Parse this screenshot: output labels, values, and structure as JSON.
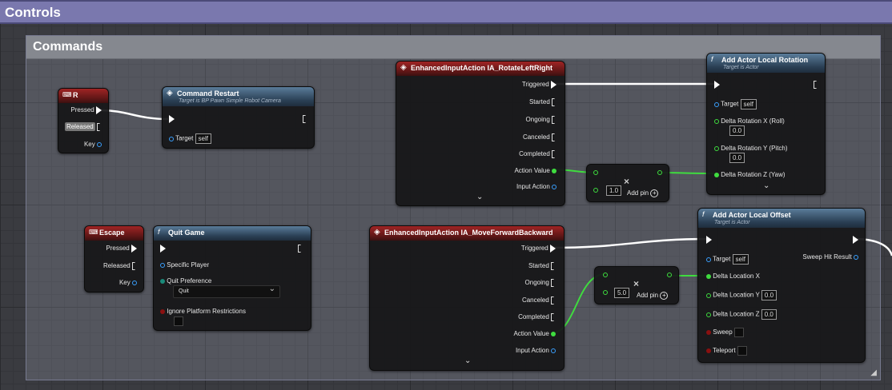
{
  "top_title": "Controls",
  "comment_title": "Commands",
  "nodes": {
    "key_r": {
      "title": "R",
      "pressed": "Pressed",
      "released": "Released",
      "key": "Key"
    },
    "command_restart": {
      "title": "Command Restart",
      "subtitle": "Target is BP Pawn Simple Robot Camera",
      "target": "Target",
      "target_value": "self"
    },
    "ia_rotate": {
      "title": "EnhancedInputAction IA_RotateLeftRight",
      "triggered": "Triggered",
      "started": "Started",
      "ongoing": "Ongoing",
      "canceled": "Canceled",
      "completed": "Completed",
      "action_value": "Action Value",
      "input_action": "Input Action"
    },
    "multiply_1": {
      "symbol": "×",
      "value": "1.0",
      "add_pin": "Add pin"
    },
    "add_rotation": {
      "title": "Add Actor Local Rotation",
      "subtitle": "Target is Actor",
      "target": "Target",
      "target_value": "self",
      "dx": "Delta Rotation X (Roll)",
      "dx_value": "0.0",
      "dy": "Delta Rotation Y (Pitch)",
      "dy_value": "0.0",
      "dz": "Delta Rotation Z (Yaw)"
    },
    "key_escape": {
      "title": "Escape",
      "pressed": "Pressed",
      "released": "Released",
      "key": "Key"
    },
    "quit_game": {
      "title": "Quit Game",
      "specific_player": "Specific Player",
      "quit_pref": "Quit Preference",
      "quit_pref_value": "Quit",
      "ignore": "Ignore Platform Restrictions"
    },
    "ia_move": {
      "title": "EnhancedInputAction IA_MoveForwardBackward",
      "triggered": "Triggered",
      "started": "Started",
      "ongoing": "Ongoing",
      "canceled": "Canceled",
      "completed": "Completed",
      "action_value": "Action Value",
      "input_action": "Input Action"
    },
    "multiply_2": {
      "symbol": "×",
      "value": "5.0",
      "add_pin": "Add pin"
    },
    "add_offset": {
      "title": "Add Actor Local Offset",
      "subtitle": "Target is Actor",
      "target": "Target",
      "target_value": "self",
      "sweep_hit": "Sweep Hit Result",
      "lx": "Delta Location X",
      "ly": "Delta Location Y",
      "ly_value": "0.0",
      "lz": "Delta Location Z",
      "lz_value": "0.0",
      "sweep": "Sweep",
      "teleport": "Teleport"
    }
  },
  "colors": {
    "exec": "#ffffff",
    "float": "#3fdc3f",
    "object": "#3aa0ff",
    "bool": "#8a1010",
    "function_header": "#2a3f54",
    "event_header": "#7a1a1a"
  }
}
